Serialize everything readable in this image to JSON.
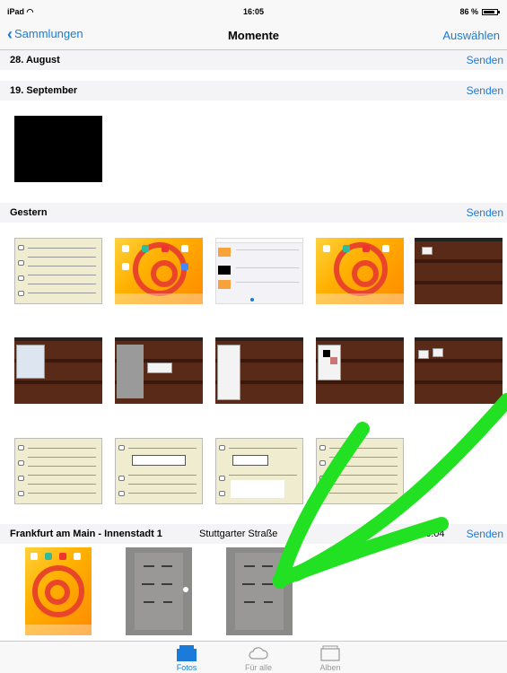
{
  "status": {
    "device": "iPad",
    "time": "16:05",
    "battery": "86 %",
    "battery_level": 0.86
  },
  "nav": {
    "back_label": "Sammlungen",
    "title": "Momente",
    "select_label": "Auswählen"
  },
  "sections": [
    {
      "title": "28. August",
      "send": "Senden"
    },
    {
      "title": "19. September",
      "send": "Senden"
    },
    {
      "title": "Gestern",
      "send": "Senden"
    },
    {
      "title": "Frankfurt am Main - Innenstadt 1",
      "subtitle": "Stuttgarter Straße",
      "time": "16:04",
      "send": "Senden"
    }
  ],
  "tabs": [
    {
      "label": "Fotos",
      "icon": "photos-icon",
      "active": true
    },
    {
      "label": "Für alle",
      "icon": "cloud-icon",
      "active": false
    },
    {
      "label": "Alben",
      "icon": "albums-icon",
      "active": false
    }
  ],
  "colors": {
    "accent": "#1a7bd8",
    "annotation": "#22e022"
  }
}
